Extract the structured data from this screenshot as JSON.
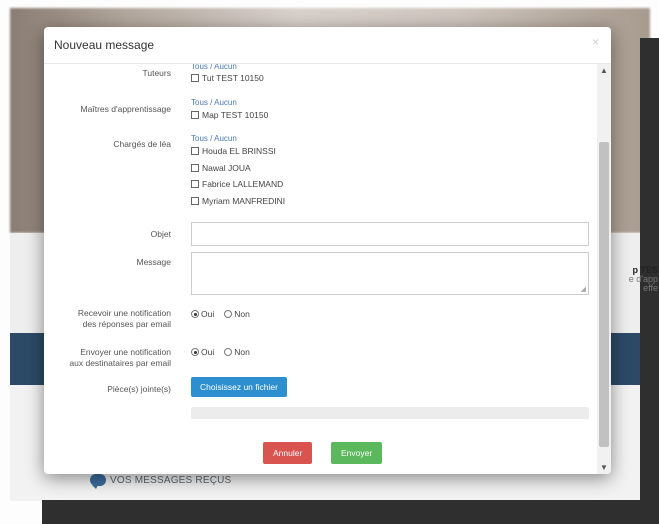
{
  "background": {
    "side_text": [
      "p TES",
      "e d'app",
      "effe"
    ],
    "messages_label": "VOS MESSAGES REÇUS"
  },
  "modal": {
    "title": "Nouveau message",
    "close_glyph": "×",
    "all_none": {
      "all": "Tous",
      "sep": " / ",
      "none": "Aucun"
    },
    "fields": {
      "tuteurs": {
        "label": "Tuteurs",
        "items": [
          "Tut TEST 10150"
        ]
      },
      "maitres": {
        "label": "Maîtres d'apprentissage",
        "items": [
          "Map TEST 10150"
        ]
      },
      "charges": {
        "label": "Chargés de léa",
        "items": [
          "Houda EL BRINSSI",
          "Nawal JOUA",
          "Fabrice LALLEMAND",
          "Myriam MANFREDINI"
        ]
      },
      "objet": {
        "label": "Objet",
        "value": ""
      },
      "message": {
        "label": "Message",
        "value": ""
      },
      "notif_reponses": {
        "label_line1": "Recevoir une notification",
        "label_line2": "des réponses par email",
        "yes": "Oui",
        "no": "Non",
        "selected": "Oui"
      },
      "notif_destinataires": {
        "label_line1": "Envoyer une notification",
        "label_line2": "aux destinataires par email",
        "yes": "Oui",
        "no": "Non",
        "selected": "Oui"
      },
      "pieces": {
        "label": "Pièce(s) jointe(s)",
        "button": "Choisissez un fichier"
      }
    },
    "buttons": {
      "cancel": "Annuler",
      "send": "Envoyer"
    }
  }
}
